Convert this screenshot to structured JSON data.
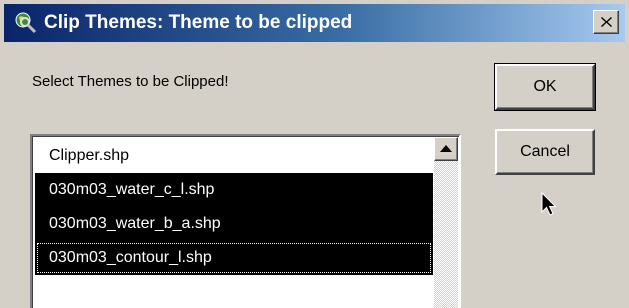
{
  "window": {
    "title": "Clip Themes: Theme to be clipped"
  },
  "prompt": "Select Themes to be Clipped!",
  "buttons": {
    "ok": "OK",
    "cancel": "Cancel"
  },
  "themes": [
    {
      "label": "Clipper.shp",
      "selected": false
    },
    {
      "label": "030m03_water_c_l.shp",
      "selected": true
    },
    {
      "label": "030m03_water_b_a.shp",
      "selected": true
    },
    {
      "label": "030m03_contour_l.shp",
      "selected": true
    }
  ],
  "colors": {
    "title_gradient_start": "#0a246a",
    "title_gradient_end": "#a6caf0",
    "face": "#d4d0c8",
    "selection": "#000000"
  },
  "icons": {
    "app": "globe-magnifier-icon",
    "close": "close-icon",
    "scroll_up": "arrow-up-icon",
    "cursor": "mouse-pointer-icon"
  }
}
